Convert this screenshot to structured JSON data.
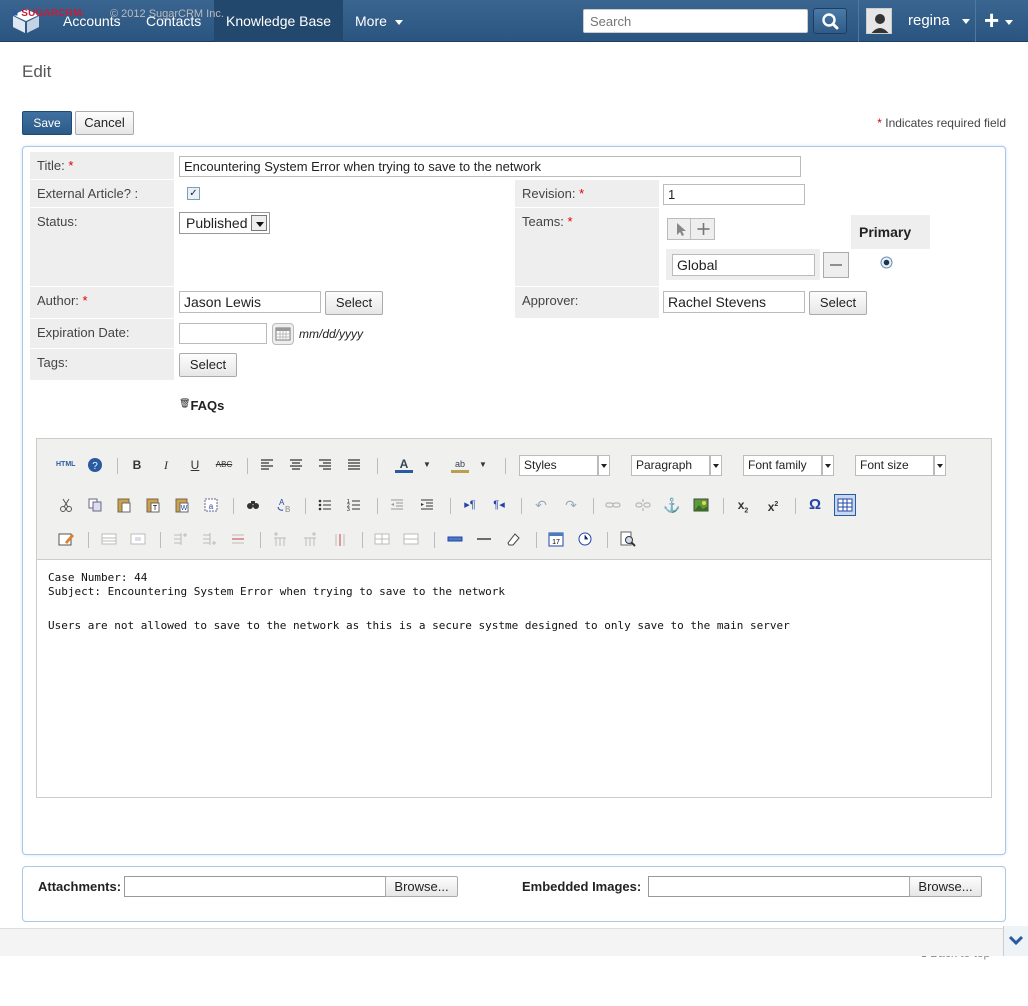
{
  "nav": {
    "items": [
      "Accounts",
      "Contacts",
      "Knowledge Base",
      "More"
    ],
    "search_placeholder": "Search",
    "user": "regina",
    "plus": "+"
  },
  "page": {
    "title": "Edit",
    "save_label": "Save",
    "cancel_label": "Cancel",
    "required_note": "Indicates required field"
  },
  "form": {
    "title_label": "Title:",
    "title_value": "Encountering System Error when trying to save to the network",
    "external_label": "External Article? :",
    "revision_label": "Revision:",
    "revision_value": "1",
    "status_label": "Status:",
    "status_value": "Published",
    "teams_label": "Teams:",
    "primary_label": "Primary",
    "team_value": "Global",
    "author_label": "Author:",
    "author_value": "Jason Lewis",
    "approver_label": "Approver:",
    "approver_value": "Rachel Stevens",
    "select_label": "Select",
    "expiration_label": "Expiration Date:",
    "date_hint": "mm/dd/yyyy",
    "tags_label": "Tags:",
    "faqs_label": "FAQs"
  },
  "toolbar": {
    "styles": "Styles",
    "paragraph": "Paragraph",
    "font_family": "Font family",
    "font_size": "Font size"
  },
  "editor": {
    "line1": "Case Number: 44",
    "line2": "Subject: Encountering System Error when trying to save to the network",
    "line3": "Users are not allowed to save to the network as this is a secure systme designed to only save to the main server"
  },
  "attachments": {
    "attachments_label": "Attachments:",
    "embedded_label": "Embedded Images:",
    "browse_label": "Browse..."
  },
  "footer": {
    "logo": "SUGARCRM.",
    "copyright": "© 2012 SugarCRM Inc.",
    "back_to_top": "Back to top"
  }
}
